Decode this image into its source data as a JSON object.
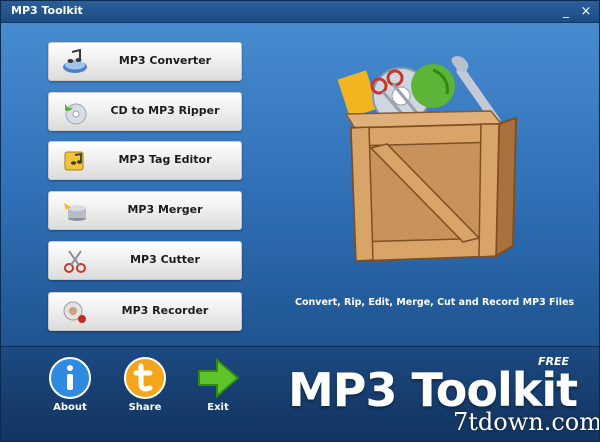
{
  "window": {
    "title": "MP3 Toolkit",
    "minimize_glyph": "_",
    "close_glyph": "×"
  },
  "buttons": [
    {
      "label": "MP3 Converter",
      "icon": "music-note-icon"
    },
    {
      "label": "CD to MP3 Ripper",
      "icon": "cd-rip-icon"
    },
    {
      "label": "MP3 Tag Editor",
      "icon": "tag-edit-icon"
    },
    {
      "label": "MP3 Merger",
      "icon": "merge-icon"
    },
    {
      "label": "MP3 Cutter",
      "icon": "scissors-icon"
    },
    {
      "label": "MP3 Recorder",
      "icon": "record-icon"
    }
  ],
  "tagline": "Convert, Rip, Edit, Merge, Cut and Record MP3 Files",
  "footer": {
    "about": {
      "label": "About",
      "icon": "info-icon"
    },
    "share": {
      "label": "Share",
      "icon": "share-t-icon"
    },
    "exit": {
      "label": "Exit",
      "icon": "arrow-right-icon"
    }
  },
  "brand": {
    "name": "MP3 Toolkit",
    "badge": "FREE"
  },
  "watermark": "7tdown.com",
  "colors": {
    "background_top": "#4a8fd3",
    "background_bottom": "#173f72",
    "footer": "#163c6b",
    "button_face": "#f0f0f0",
    "crate_wood": "#c8935a"
  }
}
